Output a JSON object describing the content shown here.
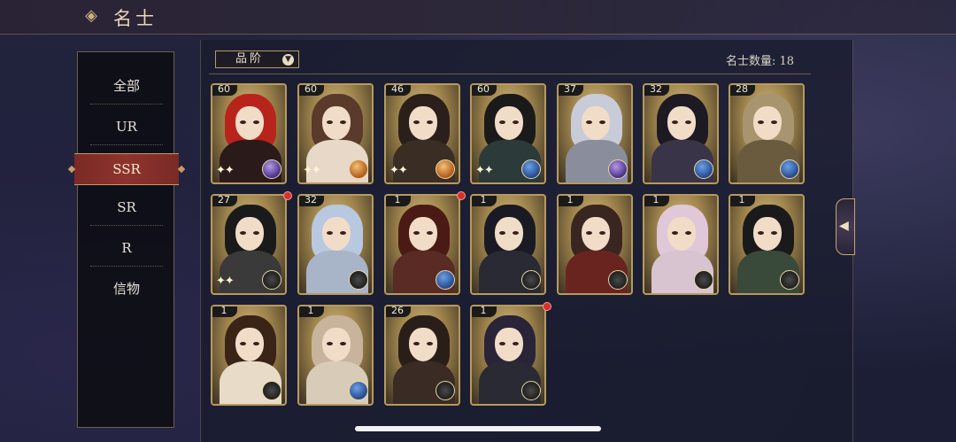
{
  "header": {
    "title": "名士",
    "emblem_icon": "cloud-swirl-icon"
  },
  "sidebar": {
    "items": [
      {
        "label": "全部",
        "active": false
      },
      {
        "label": "UR",
        "active": false
      },
      {
        "label": "SSR",
        "active": true
      },
      {
        "label": "SR",
        "active": false
      },
      {
        "label": "R",
        "active": false
      },
      {
        "label": "信物",
        "active": false
      }
    ]
  },
  "filter": {
    "label": "品阶",
    "icon": "chevron-down-icon"
  },
  "count_label": "名士数量: 18",
  "cards": [
    {
      "level": "60",
      "hair": "#b8241c",
      "robe": "#2a1a1a",
      "item": "purple",
      "sparkles": true,
      "badge": false
    },
    {
      "level": "60",
      "hair": "#5a3a2a",
      "robe": "#e8d8c8",
      "item": "orange",
      "sparkles": true,
      "badge": false
    },
    {
      "level": "46",
      "hair": "#2a1f1a",
      "robe": "#3a2e24",
      "item": "orange",
      "sparkles": true,
      "badge": false
    },
    {
      "level": "60",
      "hair": "#1a1a1a",
      "robe": "#2c3a3a",
      "item": "blue",
      "sparkles": true,
      "badge": false
    },
    {
      "level": "37",
      "hair": "#c8ccd8",
      "robe": "#8a8e9c",
      "item": "purple",
      "sparkles": false,
      "badge": false
    },
    {
      "level": "32",
      "hair": "#1e1a24",
      "robe": "#3a3448",
      "item": "blue",
      "sparkles": false,
      "badge": false
    },
    {
      "level": "28",
      "hair": "#a8946e",
      "robe": "#6a5a3e",
      "item": "blue",
      "sparkles": false,
      "badge": false
    },
    {
      "level": "27",
      "hair": "#1a1a1a",
      "robe": "#3a3a3a",
      "item": "empty",
      "sparkles": true,
      "badge": true
    },
    {
      "level": "32",
      "hair": "#b8c8e0",
      "robe": "#a8b4c8",
      "item": "empty",
      "sparkles": false,
      "badge": false
    },
    {
      "level": "1",
      "hair": "#4a1a14",
      "robe": "#5a2a24",
      "item": "blue",
      "sparkles": false,
      "badge": true
    },
    {
      "level": "1",
      "hair": "#1a1a24",
      "robe": "#2a2a34",
      "item": "empty",
      "sparkles": false,
      "badge": false
    },
    {
      "level": "1",
      "hair": "#3a2620",
      "robe": "#6a2420",
      "item": "empty",
      "sparkles": false,
      "badge": false
    },
    {
      "level": "1",
      "hair": "#e0c8d8",
      "robe": "#d8c4d0",
      "item": "empty",
      "sparkles": false,
      "badge": false
    },
    {
      "level": "1",
      "hair": "#1a1a1a",
      "robe": "#3a4a3a",
      "item": "empty",
      "sparkles": false,
      "badge": false
    },
    {
      "level": "1",
      "hair": "#3a2418",
      "robe": "#e8dcc8",
      "item": "empty",
      "sparkles": false,
      "badge": false
    },
    {
      "level": "1",
      "hair": "#c8b49c",
      "robe": "#d8ccb8",
      "item": "blue",
      "sparkles": false,
      "badge": false
    },
    {
      "level": "26",
      "hair": "#2a1e18",
      "robe": "#3a2c24",
      "item": "empty",
      "sparkles": false,
      "badge": false
    },
    {
      "level": "1",
      "hair": "#2a2438",
      "robe": "#2a2a34",
      "item": "empty",
      "sparkles": false,
      "badge": true
    }
  ],
  "right_tab_icon": "arrow-left-icon"
}
